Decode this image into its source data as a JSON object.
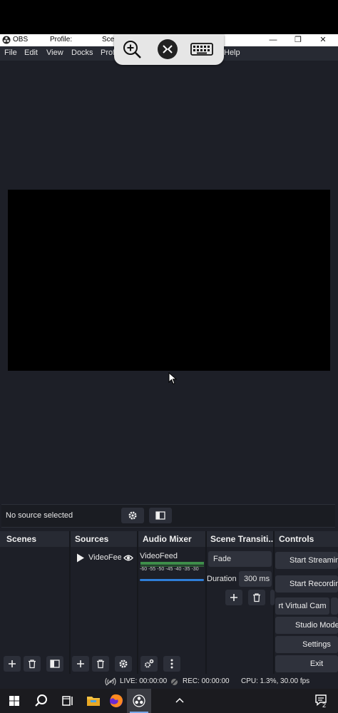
{
  "titlebar": {
    "app": "OBS",
    "profile": "Profile:",
    "scene": "Scen",
    "min": "—",
    "max": "❐",
    "close": "✕"
  },
  "menu": [
    "File",
    "Edit",
    "View",
    "Docks",
    "Prof",
    "Help"
  ],
  "source_bar": {
    "text": "No source selected"
  },
  "docks": {
    "scenes": "Scenes",
    "sources": "Sources",
    "audio_mixer": "Audio Mixer",
    "transitions": "Scene Transiti...",
    "controls": "Controls"
  },
  "sources": {
    "item": "VideoFee"
  },
  "mixer": {
    "channel": "VideoFeed",
    "ticks": [
      "-60",
      "-55",
      "-50",
      "-45",
      "-40",
      "-35",
      "-30"
    ]
  },
  "transitions": {
    "type": "Fade",
    "duration_label": "Duration",
    "duration_value": "300 ms"
  },
  "controls": [
    "Start Streamin",
    "Start Recordin",
    "rt Virtual Cam",
    "Studio Mode",
    "Settings",
    "Exit"
  ],
  "status": {
    "live": "LIVE: 00:00:00",
    "rec": "REC: 00:00:00",
    "cpu": "CPU: 1.3%, 30.00 fps"
  },
  "taskbar": {
    "notif_count": "2"
  },
  "colors": {
    "bg": "#1d1f27",
    "header": "#272a33",
    "button": "#2f323c",
    "meter_green": "#3e8e4a",
    "slider_blue": "#2f7ed8"
  }
}
